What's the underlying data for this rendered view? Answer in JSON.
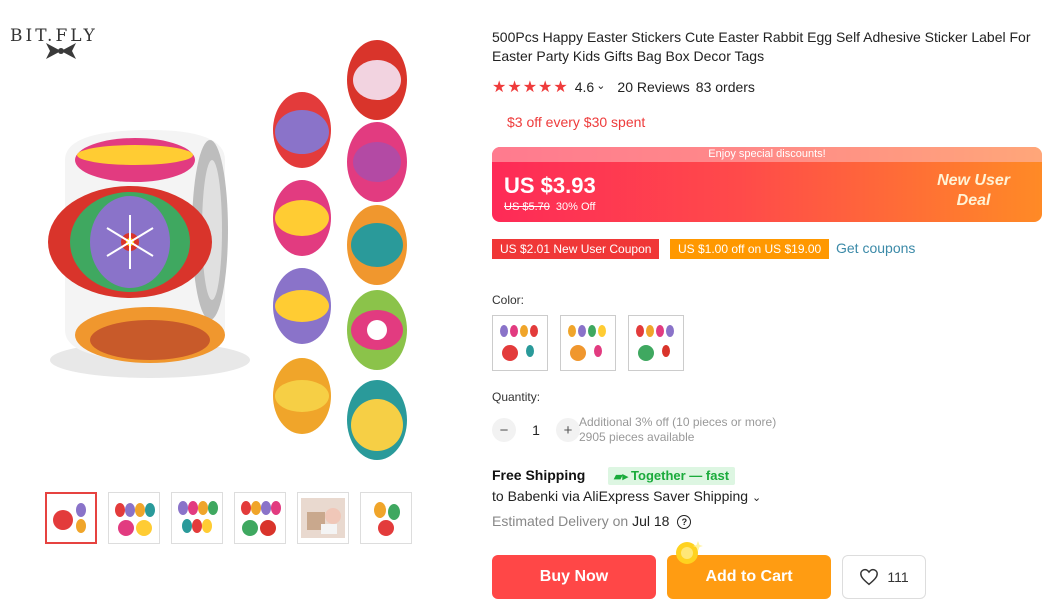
{
  "brand": {
    "name": "BIT.FLY"
  },
  "product": {
    "title": "500Pcs Happy Easter Stickers Cute Easter Rabbit Egg Self Adhesive Sticker Label For Easter Party Kids Gifts Bag Box Decor Tags",
    "rating": "4.6",
    "rating_caret": "⌄",
    "reviews": "20 Reviews",
    "orders": "83 orders",
    "stars": "★★★★★"
  },
  "promo": {
    "text": "$3 off every $30 spent"
  },
  "deal": {
    "banner": "Enjoy special discounts!",
    "price": "US $3.93",
    "old_price": "US $5.70",
    "discount": "30% Off",
    "tag_line1": "New User",
    "tag_line2": "Deal"
  },
  "coupons": {
    "coupon1": "US $2.01 New User Coupon",
    "coupon2": "US $1.00 off on US $19.00",
    "get": "Get coupons"
  },
  "color": {
    "label": "Color:",
    "options": [
      "option-1",
      "option-2",
      "option-3"
    ]
  },
  "quantity": {
    "label": "Quantity:",
    "minus": "−",
    "value": "1",
    "plus": "+",
    "info1": "Additional 3% off (10 pieces or more)",
    "info2": "2905 pieces available"
  },
  "shipping": {
    "free": "Free Shipping",
    "badge": "Together — fast",
    "to": "to Babenki via AliExpress Saver Shipping",
    "caret": "⌄",
    "delivery_prefix": "Estimated Delivery on",
    "delivery_date": "Jul 18",
    "help": "?"
  },
  "actions": {
    "buy": "Buy Now",
    "cart": "Add to Cart",
    "wish_count": "111"
  },
  "colors": {
    "accent": "#ff4747",
    "orange": "#ff9c12",
    "star": "#ef3b3b"
  }
}
